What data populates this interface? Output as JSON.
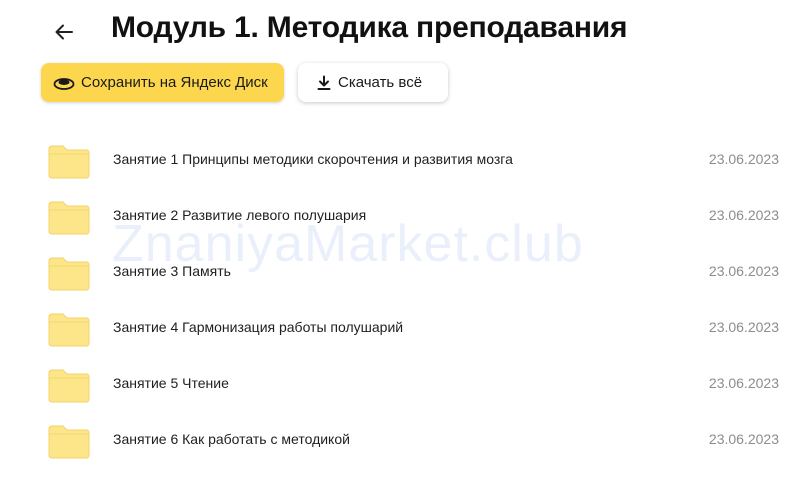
{
  "header": {
    "back_icon": "arrow-left-icon",
    "title": "Модуль 1. Методика преподавания"
  },
  "toolbar": {
    "save_label": "Сохранить на Яндекс Диск",
    "save_icon": "yandex-disk-icon",
    "download_label": "Скачать всё",
    "download_icon": "download-icon"
  },
  "files": [
    {
      "name": "Занятие 1 Принципы методики скорочтения и развития мозга",
      "date": "23.06.2023",
      "icon": "folder-icon"
    },
    {
      "name": "Занятие 2 Развитие левого полушария",
      "date": "23.06.2023",
      "icon": "folder-icon"
    },
    {
      "name": "Занятие 3 Память",
      "date": "23.06.2023",
      "icon": "folder-icon"
    },
    {
      "name": "Занятие 4 Гармонизация работы полушарий",
      "date": "23.06.2023",
      "icon": "folder-icon"
    },
    {
      "name": "Занятие 5 Чтение",
      "date": "23.06.2023",
      "icon": "folder-icon"
    },
    {
      "name": "Занятие 6 Как работать с методикой",
      "date": "23.06.2023",
      "icon": "folder-icon"
    }
  ],
  "watermark": "ZnaniyaMarket.club",
  "colors": {
    "save_button": "#fcd74e",
    "folder_fill": "#fde68a",
    "folder_tab": "#fbd96a",
    "date_text": "#8c8c8c"
  }
}
